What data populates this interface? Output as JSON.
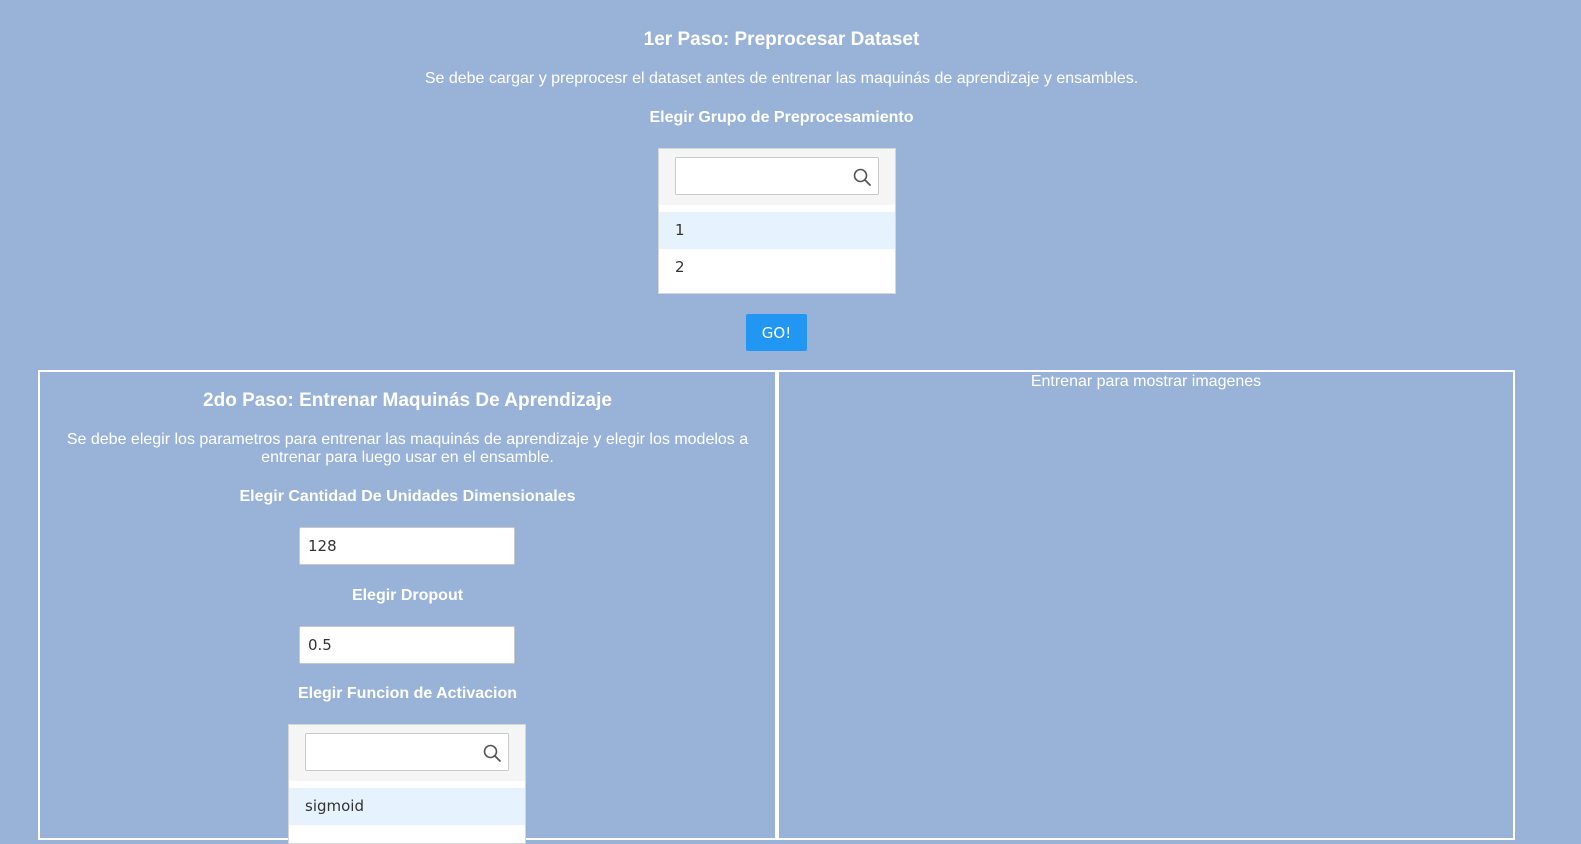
{
  "step1": {
    "title": "1er Paso: Preprocesar Dataset",
    "description": "Se debe cargar y preprocesr el dataset antes de entrenar las maquinás de aprendizaje y ensambles.",
    "group_label": "Elegir Grupo de Preprocesamiento",
    "group_select": {
      "search_value": "",
      "search_icon": "search-icon",
      "options": [
        {
          "label": "1",
          "selected": true
        },
        {
          "label": "2",
          "selected": false
        }
      ]
    },
    "go_button": "GO!"
  },
  "step2": {
    "title": "2do Paso: Entrenar Maquinás De Aprendizaje",
    "description": "Se debe elegir los parametros para entrenar las maquinás de aprendizaje y elegir los modelos a entrenar para luego usar en el ensamble.",
    "units_label": "Elegir Cantidad De Unidades Dimensionales",
    "units_value": "128",
    "dropout_label": "Elegir Dropout",
    "dropout_value": "0.5",
    "activation_label": "Elegir Funcion de Activacion",
    "activation_select": {
      "search_value": "",
      "search_icon": "search-icon",
      "options": [
        {
          "label": "sigmoid",
          "selected": true
        }
      ]
    }
  },
  "images_panel": {
    "placeholder": "Entrenar para mostrar imagenes"
  },
  "colors": {
    "background": "#99b2d8",
    "accent": "#2196f3",
    "selected_option": "#e6f2fd",
    "text": "#ffffff"
  }
}
